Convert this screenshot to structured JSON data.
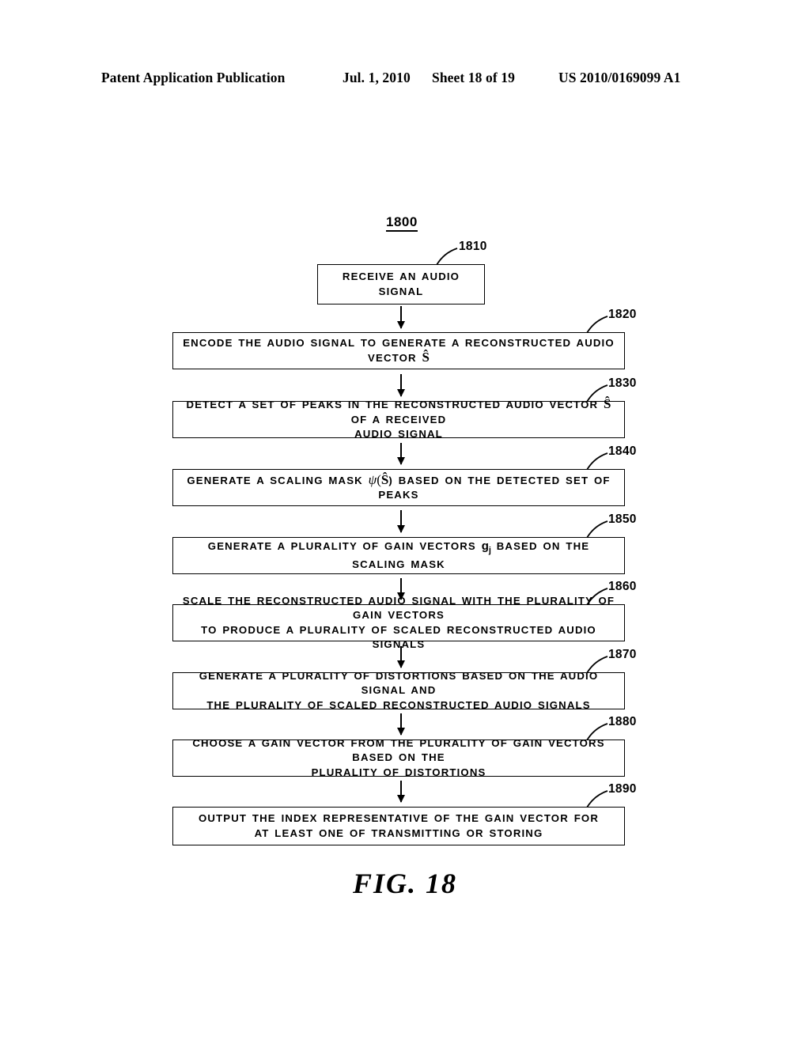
{
  "header": {
    "publication": "Patent Application Publication",
    "date": "Jul. 1, 2010",
    "sheet": "Sheet 18 of 19",
    "patent_number": "US 2010/0169099 A1"
  },
  "figure": {
    "id_label": "1800",
    "caption": "FIG. 18"
  },
  "nodes": [
    {
      "ref": "1810",
      "text_line1": "RECEIVE AN AUDIO SIGNAL",
      "text_line2": ""
    },
    {
      "ref": "1820",
      "text_line1": "ENCODE THE AUDIO SIGNAL TO GENERATE A RECONSTRUCTED AUDIO VECTOR Ŝ",
      "text_line2": ""
    },
    {
      "ref": "1830",
      "text_line1": "DETECT A SET OF PEAKS IN THE RECONSTRUCTED AUDIO VECTOR Ŝ OF A RECEIVED",
      "text_line2": "AUDIO SIGNAL"
    },
    {
      "ref": "1840",
      "text_line1": "GENERATE A SCALING MASK ψ (Ŝ) BASED ON THE DETECTED SET OF PEAKS",
      "text_line2": ""
    },
    {
      "ref": "1850",
      "text_line1": "GENERATE A PLURALITY OF GAIN VECTORS gj BASED ON THE SCALING MASK",
      "text_line2": ""
    },
    {
      "ref": "1860",
      "text_line1": "SCALE THE RECONSTRUCTED AUDIO SIGNAL WITH THE PLURALITY OF GAIN VECTORS",
      "text_line2": "TO PRODUCE A PLURALITY OF SCALED RECONSTRUCTED AUDIO SIGNALS"
    },
    {
      "ref": "1870",
      "text_line1": "GENERATE A PLURALITY OF DISTORTIONS BASED ON THE AUDIO SIGNAL AND",
      "text_line2": "THE PLURALITY OF SCALED RECONSTRUCTED AUDIO SIGNALS"
    },
    {
      "ref": "1880",
      "text_line1": "CHOOSE A GAIN VECTOR FROM THE PLURALITY OF GAIN VECTORS BASED ON THE",
      "text_line2": "PLURALITY OF DISTORTIONS"
    },
    {
      "ref": "1890",
      "text_line1": "OUTPUT THE INDEX REPRESENTATIVE OF THE GAIN VECTOR FOR",
      "text_line2": "AT LEAST ONE OF TRANSMITTING OR STORING"
    }
  ],
  "symbols": {
    "s_hat": "Ŝ",
    "psi": "ψ",
    "gain_vector": "g",
    "gain_subscript": "j"
  },
  "node_text_segments": {
    "n1820": {
      "pre": "ENCODE THE AUDIO SIGNAL TO GENERATE A RECONSTRUCTED AUDIO VECTOR ",
      "post": ""
    },
    "n1830a": {
      "pre": "DETECT A SET OF PEAKS IN THE RECONSTRUCTED AUDIO VECTOR ",
      "post": " OF A RECEIVED"
    },
    "n1830b": "AUDIO SIGNAL",
    "n1840": {
      "pre": "GENERATE A SCALING MASK ",
      "mid": "(",
      "post": ") BASED ON THE DETECTED SET OF PEAKS"
    },
    "n1850": {
      "pre": "GENERATE A PLURALITY OF GAIN VECTORS ",
      "post": " BASED ON THE SCALING MASK"
    }
  }
}
